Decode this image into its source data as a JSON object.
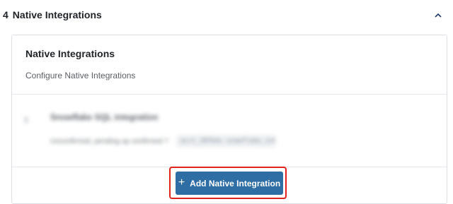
{
  "section": {
    "number": "4",
    "title": "Native Integrations",
    "toggle_icon": "chevron-up-icon"
  },
  "card": {
    "title": "Native Integrations",
    "subtitle": "Configure Native Integrations"
  },
  "integration": {
    "expand_icon": "chevron-right-icon",
    "name": "Snowflake SQL integration",
    "prompt": "Unconfirmed, pending op confirmed ?",
    "snippet": "acct_28fb4c.snowflake_int"
  },
  "actions": {
    "add_icon": "plus-icon",
    "add_label": "Add Native Integration"
  },
  "colors": {
    "button": "#2f6ea4",
    "highlight": "#e0221a",
    "border": "#dcdfe4"
  }
}
